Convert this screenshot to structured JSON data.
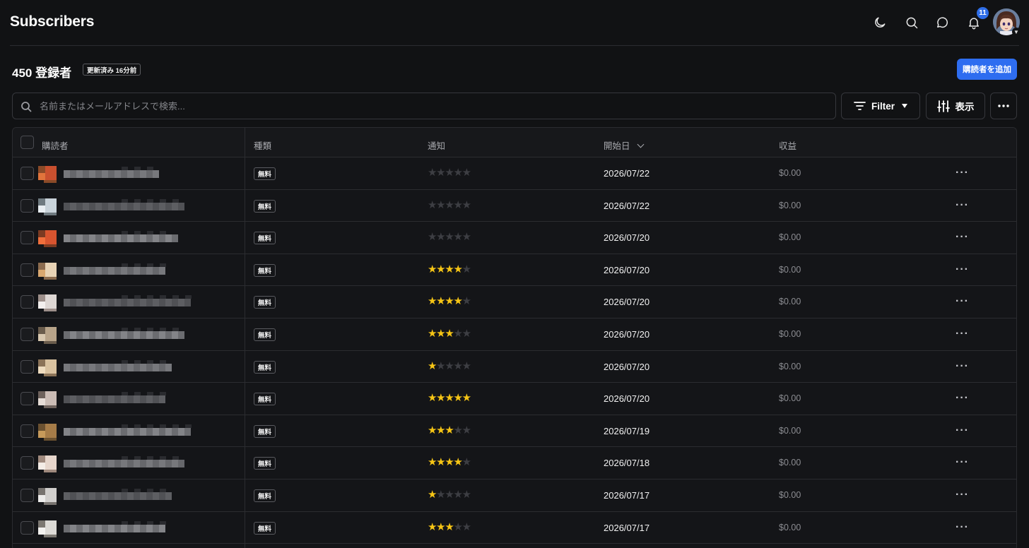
{
  "header": {
    "title": "Subscribers",
    "notification_count": "11"
  },
  "summary": {
    "count_label": "450 登録者",
    "updated_label": "更新済み 16分前",
    "add_button_label": "購読者を追加"
  },
  "search": {
    "placeholder": "名前またはメールアドレスで検索...",
    "value": ""
  },
  "toolbar": {
    "filter_label": "Filter",
    "view_label": "表示"
  },
  "table": {
    "columns": {
      "subscriber": "購読者",
      "type": "種類",
      "notification": "通知",
      "start_date": "開始日",
      "revenue": "収益"
    },
    "rows": [
      {
        "type": "無料",
        "stars": 0,
        "date": "2026/07/22",
        "revenue": "$0.00",
        "swatch": [
          "#c9502f",
          "#8a4a28",
          "#e0743c"
        ]
      },
      {
        "type": "無料",
        "stars": 0,
        "date": "2026/07/22",
        "revenue": "$0.00",
        "swatch": [
          "#c9d3da",
          "#6f7a80",
          "#e9eef2"
        ]
      },
      {
        "type": "無料",
        "stars": 0,
        "date": "2026/07/20",
        "revenue": "$0.00",
        "swatch": [
          "#d8542f",
          "#7b3a22",
          "#f06f3c"
        ]
      },
      {
        "type": "無料",
        "stars": 4,
        "date": "2026/07/20",
        "revenue": "$0.00",
        "swatch": [
          "#e8d3b5",
          "#8c6c4f",
          "#d9a870"
        ]
      },
      {
        "type": "無料",
        "stars": 4,
        "date": "2026/07/20",
        "revenue": "$0.00",
        "swatch": [
          "#ded7d4",
          "#9d8f8a",
          "#f3efee"
        ]
      },
      {
        "type": "無料",
        "stars": 3,
        "date": "2026/07/20",
        "revenue": "$0.00",
        "swatch": [
          "#b8a48a",
          "#6a5c4c",
          "#d8c8b0"
        ]
      },
      {
        "type": "無料",
        "stars": 1,
        "date": "2026/07/20",
        "revenue": "$0.00",
        "swatch": [
          "#d9c2a0",
          "#8b7358",
          "#eedcbf"
        ]
      },
      {
        "type": "無料",
        "stars": 5,
        "date": "2026/07/20",
        "revenue": "$0.00",
        "swatch": [
          "#cbbcb5",
          "#6e625c",
          "#e6dcd6"
        ]
      },
      {
        "type": "無料",
        "stars": 3,
        "date": "2026/07/19",
        "revenue": "$0.00",
        "swatch": [
          "#a67c48",
          "#6b5130",
          "#c79a5a"
        ]
      },
      {
        "type": "無料",
        "stars": 4,
        "date": "2026/07/18",
        "revenue": "$0.00",
        "swatch": [
          "#e7d6cc",
          "#a08a7e",
          "#f4ece6"
        ]
      },
      {
        "type": "無料",
        "stars": 1,
        "date": "2026/07/17",
        "revenue": "$0.00",
        "swatch": [
          "#d1cfcd",
          "#77736f",
          "#ecebea"
        ]
      },
      {
        "type": "無料",
        "stars": 3,
        "date": "2026/07/17",
        "revenue": "$0.00",
        "swatch": [
          "#dcdad6",
          "#7c7872",
          "#f2f1ef"
        ]
      }
    ]
  },
  "colors": {
    "background": "#111214",
    "accent": "#2e6df0",
    "star": "#f6c515"
  }
}
